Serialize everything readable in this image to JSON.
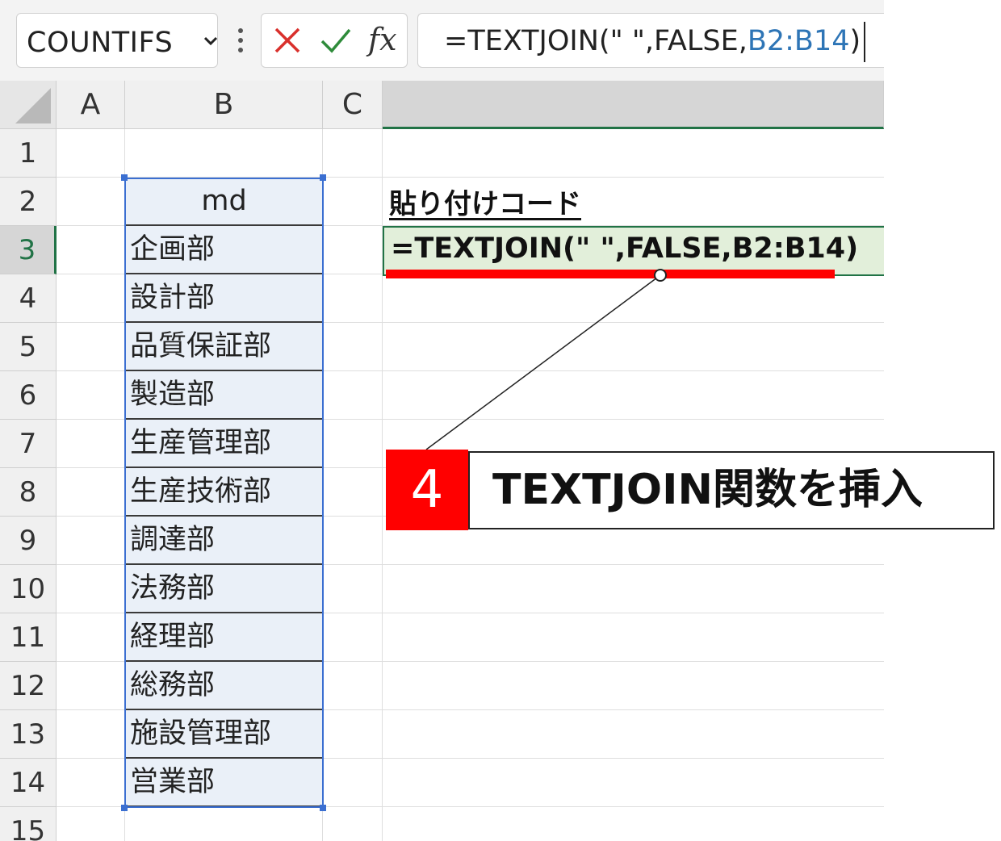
{
  "formula_bar": {
    "name_box": "COUNTIFS",
    "fx_label": "fx",
    "formula_prefix": "=TEXTJOIN(\" \",FALSE,",
    "formula_ref": "B2:B14",
    "formula_suffix": ")"
  },
  "columns": [
    "A",
    "B",
    "C"
  ],
  "rows": [
    "1",
    "2",
    "3",
    "4",
    "5",
    "6",
    "7",
    "8",
    "9",
    "10",
    "11",
    "12",
    "13",
    "14",
    "15"
  ],
  "active_row": "3",
  "column_b": {
    "header": "md",
    "items": [
      "企画部",
      "設計部",
      "品質保証部",
      "製造部",
      "生産管理部",
      "生産技術部",
      "調達部",
      "法務部",
      "経理部",
      "総務部",
      "施設管理部",
      "営業部"
    ]
  },
  "paste_label": "貼り付けコード",
  "paste_formula": "=TEXTJOIN(\" \",FALSE,B2:B14)",
  "callout": {
    "step": "4",
    "text": "TEXTJOIN関数を挿入"
  },
  "colors": {
    "accent_green": "#217346",
    "reference_blue": "#2e75b6",
    "selection_blue": "#3b6fd1",
    "highlight_red": "#ff0000",
    "cell_fill_green": "#e2efda",
    "cell_fill_blue": "#eaf0f8"
  }
}
